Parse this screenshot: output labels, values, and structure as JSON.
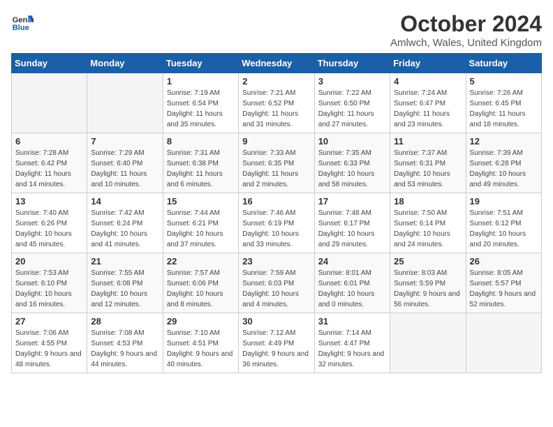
{
  "header": {
    "logo_line1": "General",
    "logo_line2": "Blue",
    "month_title": "October 2024",
    "location": "Amlwch, Wales, United Kingdom"
  },
  "weekdays": [
    "Sunday",
    "Monday",
    "Tuesday",
    "Wednesday",
    "Thursday",
    "Friday",
    "Saturday"
  ],
  "weeks": [
    [
      {
        "day": "",
        "sunrise": "",
        "sunset": "",
        "daylight": ""
      },
      {
        "day": "",
        "sunrise": "",
        "sunset": "",
        "daylight": ""
      },
      {
        "day": "1",
        "sunrise": "Sunrise: 7:19 AM",
        "sunset": "Sunset: 6:54 PM",
        "daylight": "Daylight: 11 hours and 35 minutes."
      },
      {
        "day": "2",
        "sunrise": "Sunrise: 7:21 AM",
        "sunset": "Sunset: 6:52 PM",
        "daylight": "Daylight: 11 hours and 31 minutes."
      },
      {
        "day": "3",
        "sunrise": "Sunrise: 7:22 AM",
        "sunset": "Sunset: 6:50 PM",
        "daylight": "Daylight: 11 hours and 27 minutes."
      },
      {
        "day": "4",
        "sunrise": "Sunrise: 7:24 AM",
        "sunset": "Sunset: 6:47 PM",
        "daylight": "Daylight: 11 hours and 23 minutes."
      },
      {
        "day": "5",
        "sunrise": "Sunrise: 7:26 AM",
        "sunset": "Sunset: 6:45 PM",
        "daylight": "Daylight: 11 hours and 18 minutes."
      }
    ],
    [
      {
        "day": "6",
        "sunrise": "Sunrise: 7:28 AM",
        "sunset": "Sunset: 6:42 PM",
        "daylight": "Daylight: 11 hours and 14 minutes."
      },
      {
        "day": "7",
        "sunrise": "Sunrise: 7:29 AM",
        "sunset": "Sunset: 6:40 PM",
        "daylight": "Daylight: 11 hours and 10 minutes."
      },
      {
        "day": "8",
        "sunrise": "Sunrise: 7:31 AM",
        "sunset": "Sunset: 6:38 PM",
        "daylight": "Daylight: 11 hours and 6 minutes."
      },
      {
        "day": "9",
        "sunrise": "Sunrise: 7:33 AM",
        "sunset": "Sunset: 6:35 PM",
        "daylight": "Daylight: 11 hours and 2 minutes."
      },
      {
        "day": "10",
        "sunrise": "Sunrise: 7:35 AM",
        "sunset": "Sunset: 6:33 PM",
        "daylight": "Daylight: 10 hours and 58 minutes."
      },
      {
        "day": "11",
        "sunrise": "Sunrise: 7:37 AM",
        "sunset": "Sunset: 6:31 PM",
        "daylight": "Daylight: 10 hours and 53 minutes."
      },
      {
        "day": "12",
        "sunrise": "Sunrise: 7:39 AM",
        "sunset": "Sunset: 6:28 PM",
        "daylight": "Daylight: 10 hours and 49 minutes."
      }
    ],
    [
      {
        "day": "13",
        "sunrise": "Sunrise: 7:40 AM",
        "sunset": "Sunset: 6:26 PM",
        "daylight": "Daylight: 10 hours and 45 minutes."
      },
      {
        "day": "14",
        "sunrise": "Sunrise: 7:42 AM",
        "sunset": "Sunset: 6:24 PM",
        "daylight": "Daylight: 10 hours and 41 minutes."
      },
      {
        "day": "15",
        "sunrise": "Sunrise: 7:44 AM",
        "sunset": "Sunset: 6:21 PM",
        "daylight": "Daylight: 10 hours and 37 minutes."
      },
      {
        "day": "16",
        "sunrise": "Sunrise: 7:46 AM",
        "sunset": "Sunset: 6:19 PM",
        "daylight": "Daylight: 10 hours and 33 minutes."
      },
      {
        "day": "17",
        "sunrise": "Sunrise: 7:48 AM",
        "sunset": "Sunset: 6:17 PM",
        "daylight": "Daylight: 10 hours and 29 minutes."
      },
      {
        "day": "18",
        "sunrise": "Sunrise: 7:50 AM",
        "sunset": "Sunset: 6:14 PM",
        "daylight": "Daylight: 10 hours and 24 minutes."
      },
      {
        "day": "19",
        "sunrise": "Sunrise: 7:51 AM",
        "sunset": "Sunset: 6:12 PM",
        "daylight": "Daylight: 10 hours and 20 minutes."
      }
    ],
    [
      {
        "day": "20",
        "sunrise": "Sunrise: 7:53 AM",
        "sunset": "Sunset: 6:10 PM",
        "daylight": "Daylight: 10 hours and 16 minutes."
      },
      {
        "day": "21",
        "sunrise": "Sunrise: 7:55 AM",
        "sunset": "Sunset: 6:08 PM",
        "daylight": "Daylight: 10 hours and 12 minutes."
      },
      {
        "day": "22",
        "sunrise": "Sunrise: 7:57 AM",
        "sunset": "Sunset: 6:06 PM",
        "daylight": "Daylight: 10 hours and 8 minutes."
      },
      {
        "day": "23",
        "sunrise": "Sunrise: 7:59 AM",
        "sunset": "Sunset: 6:03 PM",
        "daylight": "Daylight: 10 hours and 4 minutes."
      },
      {
        "day": "24",
        "sunrise": "Sunrise: 8:01 AM",
        "sunset": "Sunset: 6:01 PM",
        "daylight": "Daylight: 10 hours and 0 minutes."
      },
      {
        "day": "25",
        "sunrise": "Sunrise: 8:03 AM",
        "sunset": "Sunset: 5:59 PM",
        "daylight": "Daylight: 9 hours and 56 minutes."
      },
      {
        "day": "26",
        "sunrise": "Sunrise: 8:05 AM",
        "sunset": "Sunset: 5:57 PM",
        "daylight": "Daylight: 9 hours and 52 minutes."
      }
    ],
    [
      {
        "day": "27",
        "sunrise": "Sunrise: 7:06 AM",
        "sunset": "Sunset: 4:55 PM",
        "daylight": "Daylight: 9 hours and 48 minutes."
      },
      {
        "day": "28",
        "sunrise": "Sunrise: 7:08 AM",
        "sunset": "Sunset: 4:53 PM",
        "daylight": "Daylight: 9 hours and 44 minutes."
      },
      {
        "day": "29",
        "sunrise": "Sunrise: 7:10 AM",
        "sunset": "Sunset: 4:51 PM",
        "daylight": "Daylight: 9 hours and 40 minutes."
      },
      {
        "day": "30",
        "sunrise": "Sunrise: 7:12 AM",
        "sunset": "Sunset: 4:49 PM",
        "daylight": "Daylight: 9 hours and 36 minutes."
      },
      {
        "day": "31",
        "sunrise": "Sunrise: 7:14 AM",
        "sunset": "Sunset: 4:47 PM",
        "daylight": "Daylight: 9 hours and 32 minutes."
      },
      {
        "day": "",
        "sunrise": "",
        "sunset": "",
        "daylight": ""
      },
      {
        "day": "",
        "sunrise": "",
        "sunset": "",
        "daylight": ""
      }
    ]
  ]
}
